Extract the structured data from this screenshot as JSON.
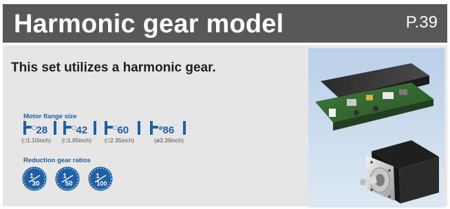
{
  "header": {
    "title": "Harmonic gear model",
    "page_ref": "P.39"
  },
  "subtitle": "This set utilizes a harmonic gear.",
  "flange_section": {
    "label": "Motor flange size",
    "items": [
      {
        "symbol": "□",
        "size": "28",
        "inch": "(□1.10inch)"
      },
      {
        "symbol": "□",
        "size": "42",
        "inch": "(□1.65inch)"
      },
      {
        "symbol": "□",
        "size": "60",
        "inch": "(□2.35inch)"
      },
      {
        "symbol": "ø",
        "size": "86",
        "inch": "(ø3.39inch)"
      }
    ]
  },
  "ratio_section": {
    "label": "Reduction gear ratios",
    "items": [
      {
        "num": "1",
        "den": "30"
      },
      {
        "num": "1",
        "den": "50"
      },
      {
        "num": "1",
        "den": "100"
      }
    ]
  },
  "colors": {
    "header_bg": "#595757",
    "panel_bg": "#e6e6e6",
    "accent": "#1d5fa8"
  }
}
